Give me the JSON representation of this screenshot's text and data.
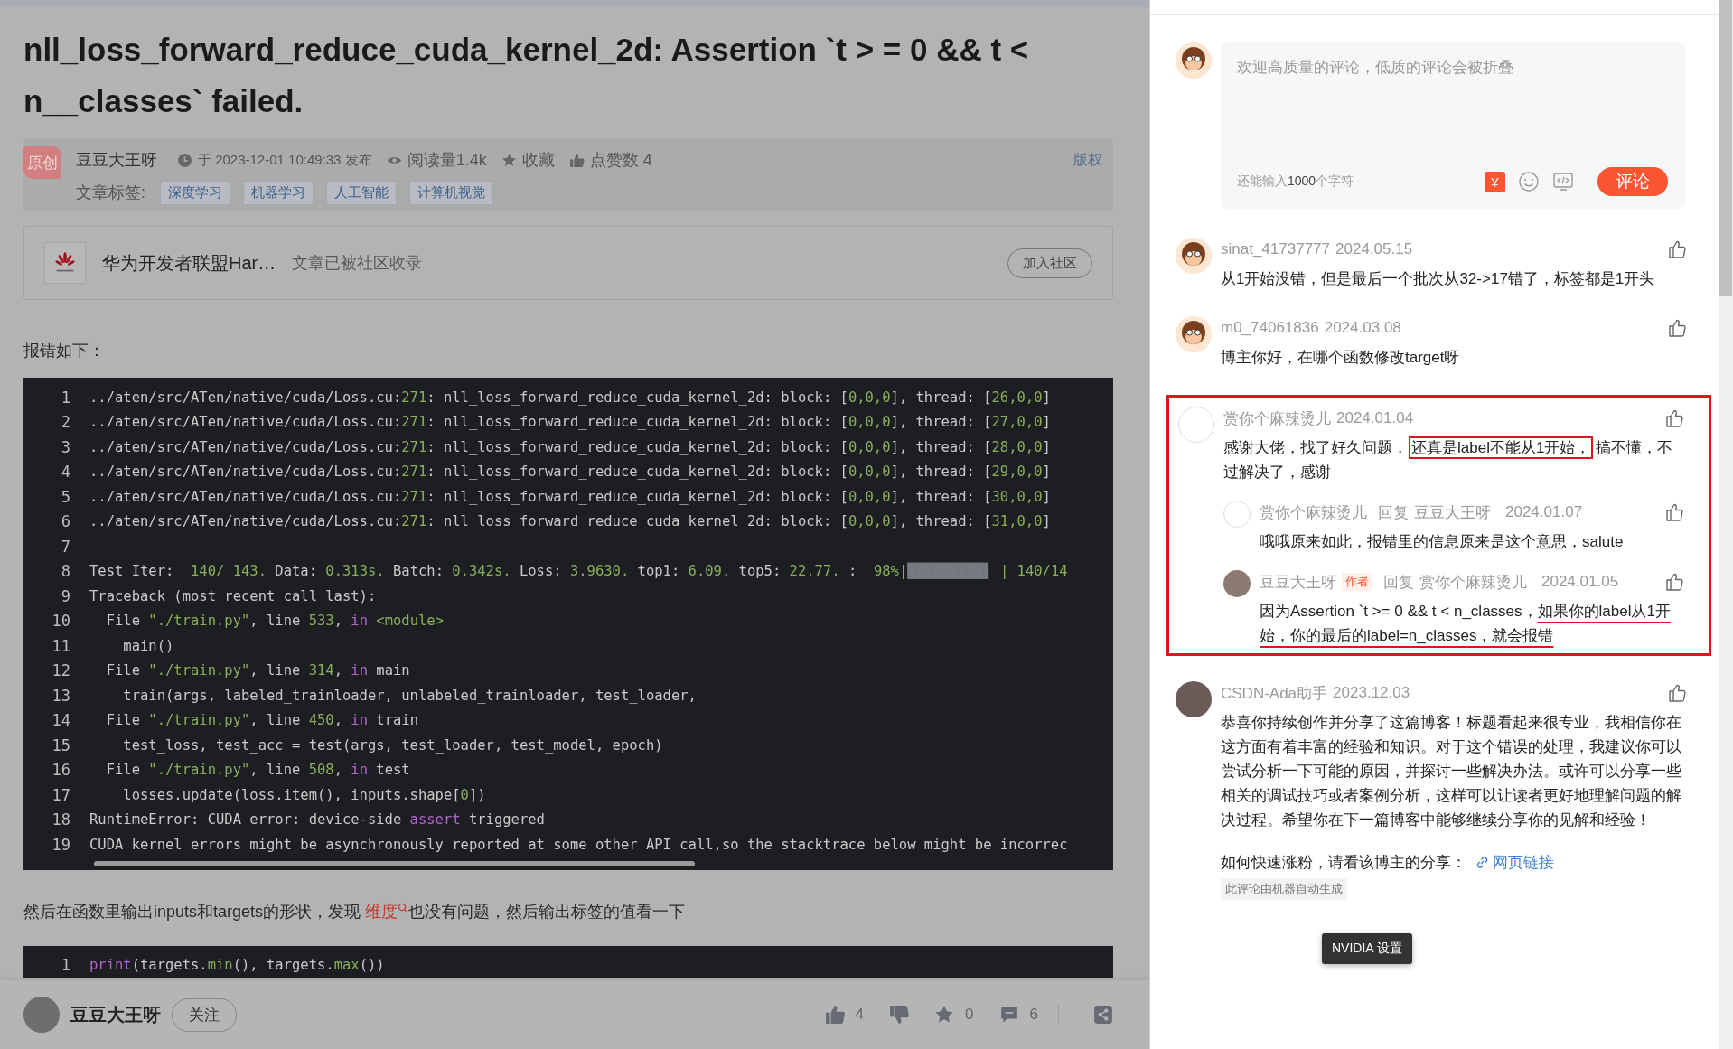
{
  "article": {
    "title": "nll_loss_forward_reduce_cuda_kernel_2d: Assertion `t  > = 0 && t  <  n__classes` failed.",
    "badge": "原创",
    "author": "豆豆大王呀",
    "published": "于 2023-12-01 10:49:33 发布",
    "reads": "阅读量1.4k",
    "favorite": "收藏",
    "likes": "点赞数 4",
    "copyright": "版权",
    "tags_label": "文章标签:",
    "tags": [
      "深度学习",
      "机器学习",
      "人工智能",
      "计算机视觉"
    ]
  },
  "community": {
    "name": "华为开发者联盟Har…",
    "note": "文章已被社区收录",
    "button": "加入社区"
  },
  "intro": "报错如下：",
  "code_blocks": [
    {
      "lines": [
        {
          "no": "1",
          "tokens": [
            {
              "kind": "plain",
              "t": "../aten/src/ATen/native/cuda/Loss.cu:"
            },
            {
              "kind": "green",
              "t": "271"
            },
            {
              "kind": "plain",
              "t": ": nll_loss_forward_reduce_cuda_kernel_2d: block: ["
            },
            {
              "kind": "green",
              "t": "0,0,0"
            },
            {
              "kind": "plain",
              "t": "], thread: ["
            },
            {
              "kind": "green",
              "t": "26,0,0"
            },
            {
              "kind": "plain",
              "t": "]"
            }
          ]
        },
        {
          "no": "2",
          "tokens": [
            {
              "kind": "plain",
              "t": "../aten/src/ATen/native/cuda/Loss.cu:"
            },
            {
              "kind": "green",
              "t": "271"
            },
            {
              "kind": "plain",
              "t": ": nll_loss_forward_reduce_cuda_kernel_2d: block: ["
            },
            {
              "kind": "green",
              "t": "0,0,0"
            },
            {
              "kind": "plain",
              "t": "], thread: ["
            },
            {
              "kind": "green",
              "t": "27,0,0"
            },
            {
              "kind": "plain",
              "t": "]"
            }
          ]
        },
        {
          "no": "3",
          "tokens": [
            {
              "kind": "plain",
              "t": "../aten/src/ATen/native/cuda/Loss.cu:"
            },
            {
              "kind": "green",
              "t": "271"
            },
            {
              "kind": "plain",
              "t": ": nll_loss_forward_reduce_cuda_kernel_2d: block: ["
            },
            {
              "kind": "green",
              "t": "0,0,0"
            },
            {
              "kind": "plain",
              "t": "], thread: ["
            },
            {
              "kind": "green",
              "t": "28,0,0"
            },
            {
              "kind": "plain",
              "t": "]"
            }
          ]
        },
        {
          "no": "4",
          "tokens": [
            {
              "kind": "plain",
              "t": "../aten/src/ATen/native/cuda/Loss.cu:"
            },
            {
              "kind": "green",
              "t": "271"
            },
            {
              "kind": "plain",
              "t": ": nll_loss_forward_reduce_cuda_kernel_2d: block: ["
            },
            {
              "kind": "green",
              "t": "0,0,0"
            },
            {
              "kind": "plain",
              "t": "], thread: ["
            },
            {
              "kind": "green",
              "t": "29,0,0"
            },
            {
              "kind": "plain",
              "t": "]"
            }
          ]
        },
        {
          "no": "5",
          "tokens": [
            {
              "kind": "plain",
              "t": "../aten/src/ATen/native/cuda/Loss.cu:"
            },
            {
              "kind": "green",
              "t": "271"
            },
            {
              "kind": "plain",
              "t": ": nll_loss_forward_reduce_cuda_kernel_2d: block: ["
            },
            {
              "kind": "green",
              "t": "0,0,0"
            },
            {
              "kind": "plain",
              "t": "], thread: ["
            },
            {
              "kind": "green",
              "t": "30,0,0"
            },
            {
              "kind": "plain",
              "t": "]"
            }
          ]
        },
        {
          "no": "6",
          "tokens": [
            {
              "kind": "plain",
              "t": "../aten/src/ATen/native/cuda/Loss.cu:"
            },
            {
              "kind": "green",
              "t": "271"
            },
            {
              "kind": "plain",
              "t": ": nll_loss_forward_reduce_cuda_kernel_2d: block: ["
            },
            {
              "kind": "green",
              "t": "0,0,0"
            },
            {
              "kind": "plain",
              "t": "], thread: ["
            },
            {
              "kind": "green",
              "t": "31,0,0"
            },
            {
              "kind": "plain",
              "t": "]"
            }
          ]
        },
        {
          "no": "7"
        },
        {
          "no": "8",
          "tokens": [
            {
              "kind": "plain",
              "t": "Test Iter:  "
            },
            {
              "kind": "green",
              "t": "140/ 143."
            },
            {
              "kind": "plain",
              "t": " Data: "
            },
            {
              "kind": "green",
              "t": "0.313s."
            },
            {
              "kind": "plain",
              "t": " Batch: "
            },
            {
              "kind": "green",
              "t": "0.342s."
            },
            {
              "kind": "plain",
              "t": " Loss: "
            },
            {
              "kind": "green",
              "t": "3.9630."
            },
            {
              "kind": "plain",
              "t": " top1: "
            },
            {
              "kind": "green",
              "t": "6.09."
            },
            {
              "kind": "plain",
              "t": " top5: "
            },
            {
              "kind": "green",
              "t": "22.77."
            },
            {
              "kind": "plain",
              "t": " :  "
            },
            {
              "kind": "green",
              "t": "98%|"
            },
            {
              "kind": "grey",
              "t": "█████████▋"
            },
            {
              "kind": "green",
              "t": " | 140/14"
            }
          ]
        },
        {
          "no": "9",
          "tokens": [
            {
              "kind": "plain",
              "t": "Traceback (most recent call last):"
            }
          ]
        },
        {
          "no": "10",
          "tokens": [
            {
              "kind": "plain",
              "t": "  File "
            },
            {
              "kind": "green",
              "t": "\"./train.py\""
            },
            {
              "kind": "plain",
              "t": ", line "
            },
            {
              "kind": "green",
              "t": "533"
            },
            {
              "kind": "plain",
              "t": ", "
            },
            {
              "kind": "purple",
              "t": "in"
            },
            {
              "kind": "green",
              "t": " <module>"
            }
          ]
        },
        {
          "no": "11",
          "tokens": [
            {
              "kind": "plain",
              "t": "    main()"
            }
          ]
        },
        {
          "no": "12",
          "tokens": [
            {
              "kind": "plain",
              "t": "  File "
            },
            {
              "kind": "green",
              "t": "\"./train.py\""
            },
            {
              "kind": "plain",
              "t": ", line "
            },
            {
              "kind": "green",
              "t": "314"
            },
            {
              "kind": "plain",
              "t": ", "
            },
            {
              "kind": "purple",
              "t": "in"
            },
            {
              "kind": "plain",
              "t": " main"
            }
          ]
        },
        {
          "no": "13",
          "tokens": [
            {
              "kind": "plain",
              "t": "    train(args, labeled_trainloader, unlabeled_trainloader, test_loader,"
            }
          ]
        },
        {
          "no": "14",
          "tokens": [
            {
              "kind": "plain",
              "t": "  File "
            },
            {
              "kind": "green",
              "t": "\"./train.py\""
            },
            {
              "kind": "plain",
              "t": ", line "
            },
            {
              "kind": "green",
              "t": "450"
            },
            {
              "kind": "plain",
              "t": ", "
            },
            {
              "kind": "purple",
              "t": "in"
            },
            {
              "kind": "plain",
              "t": " train"
            }
          ]
        },
        {
          "no": "15",
          "tokens": [
            {
              "kind": "plain",
              "t": "    test_loss, test_acc = test(args, test_loader, test_model, epoch)"
            }
          ]
        },
        {
          "no": "16",
          "tokens": [
            {
              "kind": "plain",
              "t": "  File "
            },
            {
              "kind": "green",
              "t": "\"./train.py\""
            },
            {
              "kind": "plain",
              "t": ", line "
            },
            {
              "kind": "green",
              "t": "508"
            },
            {
              "kind": "plain",
              "t": ", "
            },
            {
              "kind": "purple",
              "t": "in"
            },
            {
              "kind": "plain",
              "t": " test"
            }
          ]
        },
        {
          "no": "17",
          "tokens": [
            {
              "kind": "plain",
              "t": "    losses.update(loss.item(), inputs.shape["
            },
            {
              "kind": "green",
              "t": "0"
            },
            {
              "kind": "plain",
              "t": "])"
            }
          ]
        },
        {
          "no": "18",
          "tokens": [
            {
              "kind": "plain",
              "t": "RuntimeError: CUDA error: device-side "
            },
            {
              "kind": "purple",
              "t": "assert"
            },
            {
              "kind": "plain",
              "t": " triggered"
            }
          ]
        },
        {
          "no": "19",
          "tokens": [
            {
              "kind": "plain",
              "t": "CUDA kernel errors might be asynchronously reported at some other API call,so the stacktrace below might be incorrec"
            }
          ]
        }
      ]
    },
    {
      "lines": [
        {
          "no": "1",
          "tokens": [
            {
              "kind": "purple",
              "t": "print"
            },
            {
              "kind": "plain",
              "t": "(targets."
            },
            {
              "kind": "green",
              "t": "min"
            },
            {
              "kind": "plain",
              "t": "(), targets."
            },
            {
              "kind": "green",
              "t": "max"
            },
            {
              "kind": "plain",
              "t": "())"
            }
          ]
        }
      ]
    }
  ],
  "paragraph": {
    "before": "然后在函数里输出inputs和targets的形状，发现 ",
    "link": "维度",
    "after": "也没有问题，然后输出标签的值看一下"
  },
  "footer": {
    "author": "豆豆大王呀",
    "follow": "关注",
    "actions": [
      {
        "kind": "like",
        "count": "4"
      },
      {
        "kind": "dislike"
      },
      {
        "kind": "favorite",
        "count": "0"
      },
      {
        "kind": "comment",
        "count": "6"
      },
      {
        "kind": "share"
      }
    ]
  },
  "comment_box": {
    "placeholder": "欢迎高质量的评论，低质的评论会被折叠",
    "remaining_before": "还能输入",
    "remaining_count": "1000",
    "remaining_after": "个字符",
    "reward": "¥",
    "submit": "评论"
  },
  "comments": [
    {
      "kind": "monkey",
      "user": "sinat_41737777",
      "date": "2024.05.15",
      "text": [
        {
          "kind": "none",
          "t": "从1开始没错，但是最后一个批次从32->17错了，标签都是1开头"
        }
      ]
    },
    {
      "kind": "monkey",
      "user": "m0_74061836",
      "date": "2024.03.08",
      "text": [
        {
          "kind": "none",
          "t": "博主你好，在哪个函数修改target呀"
        }
      ]
    },
    {
      "kind": "blank",
      "highlighted": true,
      "user": "赏你个麻辣烫儿",
      "date": "2024.01.04",
      "text": [
        {
          "kind": "none",
          "t": "感谢大佬，找了好久问题，"
        },
        {
          "kind": "box",
          "t": "还真是label不能从1开始，"
        },
        {
          "kind": "none",
          "t": "搞不懂，不过解决了，感谢"
        }
      ],
      "replies": [
        {
          "kind": "blank",
          "user": "赏你个麻辣烫儿",
          "reply_label": "回复",
          "reply_to": "豆豆大王呀",
          "date": "2024.01.07",
          "text": [
            {
              "kind": "none",
              "t": "哦哦原来如此，报错里的信息原来是这个意思，salute"
            }
          ]
        },
        {
          "kind": "photo",
          "user": "豆豆大王呀",
          "tag": "作者",
          "reply_label": "回复",
          "reply_to": "赏你个麻辣烫儿",
          "date": "2024.01.05",
          "text": [
            {
              "kind": "none",
              "t": "因为Assertion `t >= 0 && t < n_classes，"
            },
            {
              "kind": "underline",
              "t": "如果你的label从1开始，你的最后的label=n_classes，就会报错"
            }
          ]
        }
      ]
    },
    {
      "kind": "robot",
      "user": "CSDN-Ada助手",
      "date": "2023.12.03",
      "text": [
        {
          "kind": "none",
          "t": "恭喜你持续创作并分享了这篇博客！标题看起来很专业，我相信你在这方面有着丰富的经验和知识。对于这个错误的处理，我建议你可以尝试分析一下可能的原因，并探讨一些解决办法。或许可以分享一些相关的调试技巧或者案例分析，这样可以让读者更好地理解问题的解决过程。希望你在下一篇博客中能够继续分享你的见解和经验！"
        }
      ],
      "share_prompt": "如何快速涨粉，请看该博主的分享：",
      "share_link": "网页链接",
      "auto_note": "此评论由机器自动生成"
    }
  ],
  "tooltip": "NVIDIA 设置"
}
